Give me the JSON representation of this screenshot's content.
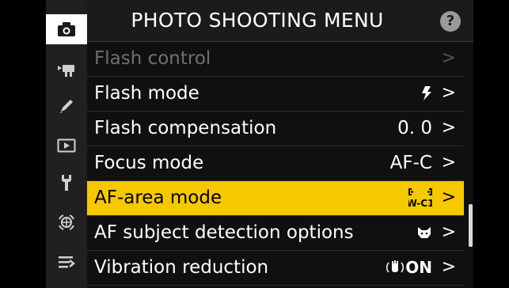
{
  "header": {
    "title": "PHOTO SHOOTING MENU",
    "help_label": "?"
  },
  "sidebar": {
    "items": [
      {
        "name": "camera-icon",
        "active": true
      },
      {
        "name": "movie-camera-icon",
        "active": false
      },
      {
        "name": "pencil-icon",
        "active": false
      },
      {
        "name": "playback-icon",
        "active": false
      },
      {
        "name": "wrench-icon",
        "active": false
      },
      {
        "name": "network-icon",
        "active": false
      },
      {
        "name": "my-menu-icon",
        "active": false
      }
    ]
  },
  "menu": {
    "items": [
      {
        "label": "Flash control",
        "value": "",
        "state": "disabled"
      },
      {
        "label": "Flash mode",
        "value_icon": "flash-icon"
      },
      {
        "label": "Flash compensation",
        "value": "0. 0"
      },
      {
        "label": "Focus mode",
        "value": "AF-C"
      },
      {
        "label": "AF-area mode",
        "value_icon": "wide-area-c1-icon",
        "state": "selected"
      },
      {
        "label": "AF subject detection options",
        "value_icon": "animal-detection-icon"
      },
      {
        "label": "Vibration reduction",
        "value_icon": "vr-icon",
        "value_text": "ON"
      }
    ],
    "chevron": ">"
  },
  "colors": {
    "selected": "#f5c800",
    "background": "#101010",
    "sidebar": "#202020"
  }
}
